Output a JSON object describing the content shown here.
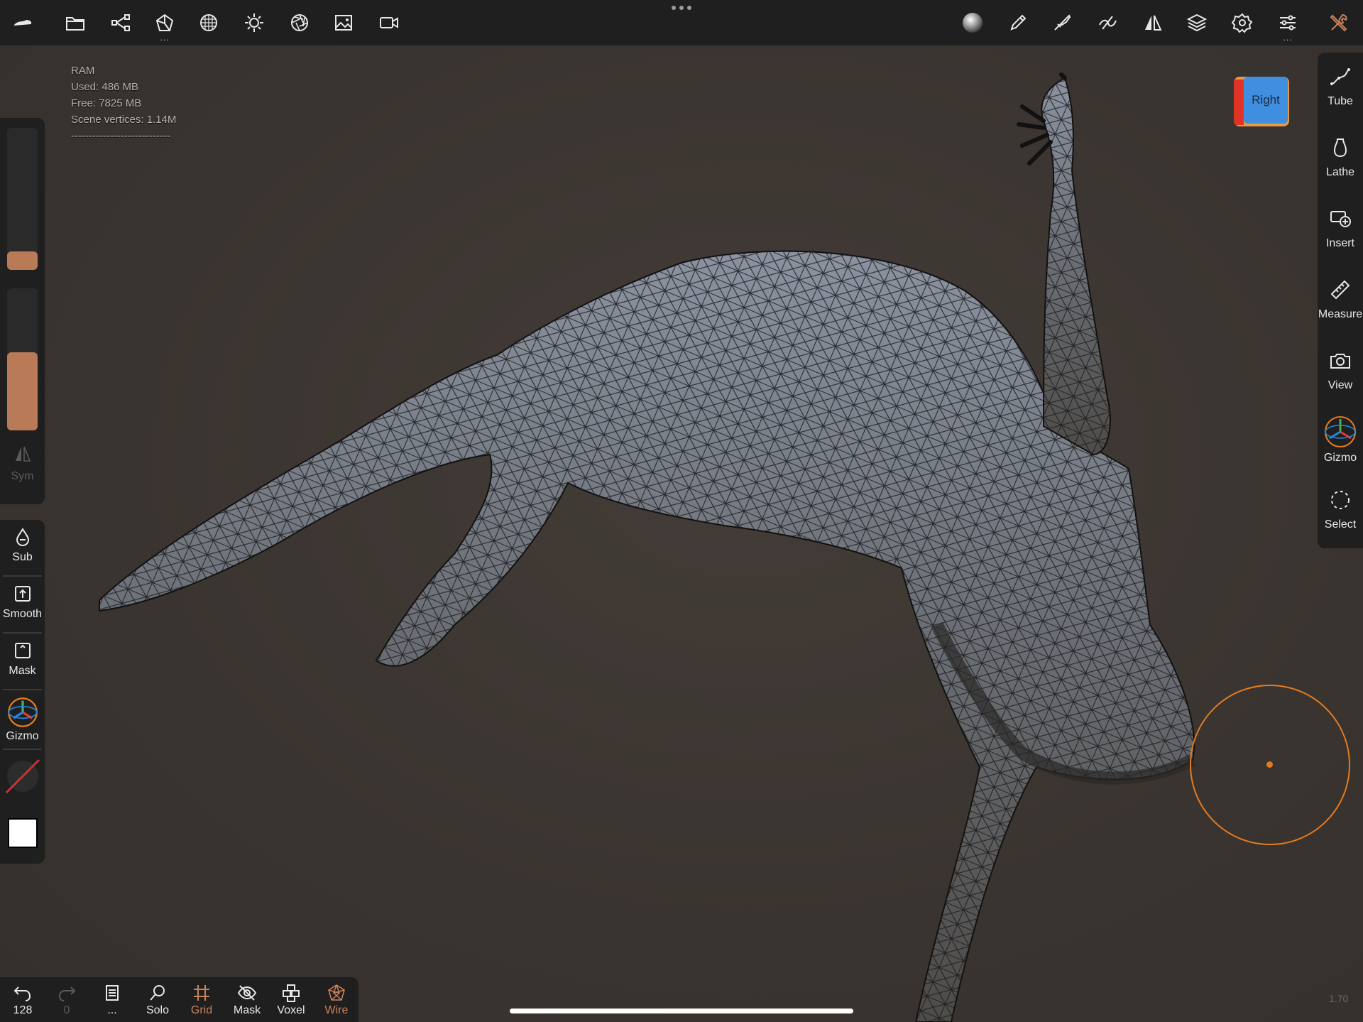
{
  "topbar": {
    "left_icons": [
      "nomad-logo-icon",
      "folder-icon",
      "scene-graph-icon",
      "primitive-icon",
      "material-icon",
      "light-icon",
      "camera-aperture-icon",
      "image-icon",
      "video-icon"
    ],
    "right_icons": [
      "matcap-sphere-icon",
      "brush-pencil-icon",
      "paint-brush-icon",
      "stroke-icon",
      "symmetry-icon",
      "layers-icon",
      "settings-icon",
      "sliders-icon",
      "tools-icon"
    ],
    "more_indicator": "..."
  },
  "stats": {
    "ram_label": "RAM",
    "used": "Used: 486 MB",
    "free": "Free: 7825 MB",
    "vertices": "Scene vertices: 1.14M",
    "divider": "----------------------------"
  },
  "viewcube": {
    "label": "Right"
  },
  "left_panel": {
    "radius_slider": 0.08,
    "intensity_slider": 0.5,
    "sym_label": "Sym",
    "items": [
      {
        "label": "Sub",
        "icon": "drop-icon"
      },
      {
        "label": "Smooth",
        "icon": "smooth-icon"
      },
      {
        "label": "Mask",
        "icon": "mask-icon"
      },
      {
        "label": "Gizmo",
        "icon": "gizmo-icon"
      }
    ]
  },
  "right_panel": {
    "items": [
      {
        "label": "Tube",
        "icon": "tube-icon"
      },
      {
        "label": "Lathe",
        "icon": "lathe-icon"
      },
      {
        "label": "Insert",
        "icon": "insert-icon"
      },
      {
        "label": "Measure",
        "icon": "ruler-icon"
      },
      {
        "label": "View",
        "icon": "camera-icon"
      },
      {
        "label": "Gizmo",
        "icon": "gizmo-icon"
      },
      {
        "label": "Select",
        "icon": "select-icon"
      }
    ]
  },
  "bottombar": {
    "undo_count": "128",
    "redo_count": "0",
    "history_more": "...",
    "items": [
      {
        "label": "Solo",
        "icon": "search-icon"
      },
      {
        "label": "Grid",
        "icon": "grid-icon",
        "active": true
      },
      {
        "label": "Mask",
        "icon": "eye-slash-icon"
      },
      {
        "label": "Voxel",
        "icon": "voxel-icon"
      },
      {
        "label": "Wire",
        "icon": "wireframe-icon",
        "active": true
      }
    ]
  },
  "version": "1.70",
  "colors": {
    "accent": "#c9825a",
    "brush": "#e37b1e",
    "panel": "#1f1f1f",
    "viewport": "#3b3531"
  }
}
